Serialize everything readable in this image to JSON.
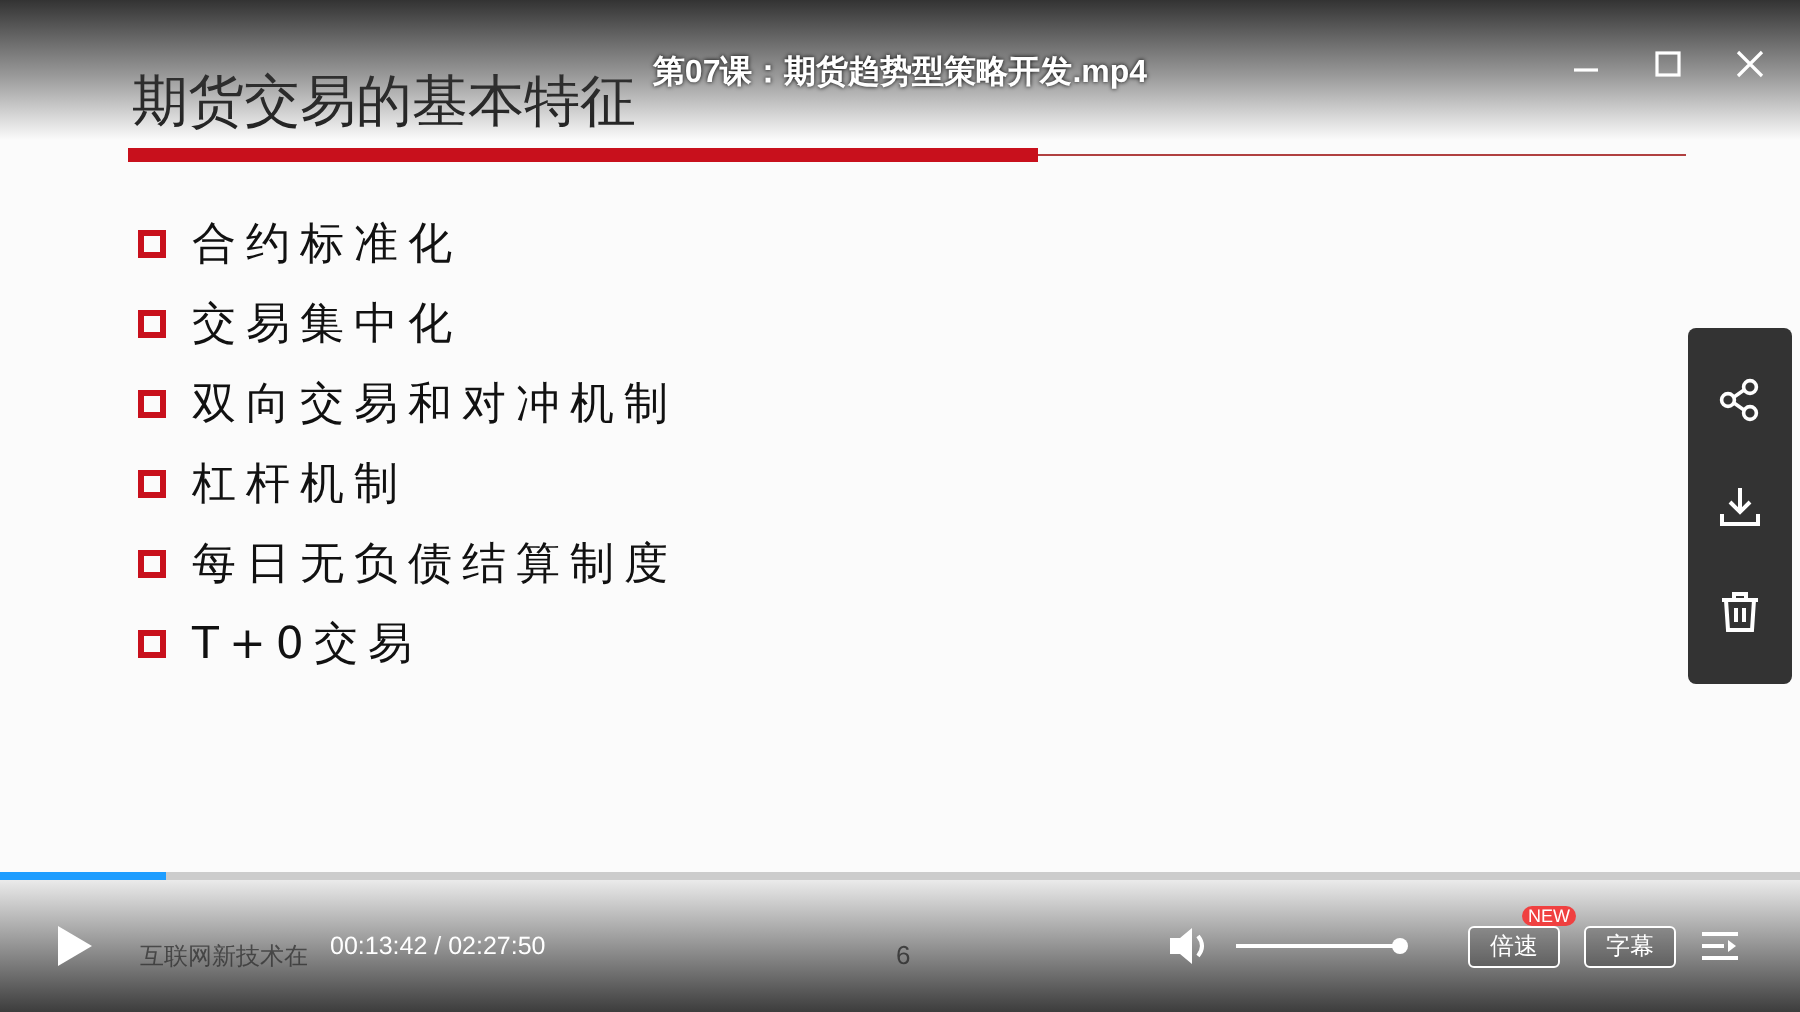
{
  "window": {
    "title": "第07课：期货趋势型策略开发.mp4"
  },
  "slide": {
    "title": "期货交易的基本特征",
    "bullets": [
      "合约标准化",
      "交易集中化",
      "双向交易和对冲机制",
      "杠杆机制",
      "每日无负债结算制度",
      "T+0交易"
    ],
    "footer": "互联网新技术在",
    "page": "6"
  },
  "player": {
    "progress": {
      "level": 0.092
    },
    "time": "00:13:42 / 02:27:50",
    "volume": {
      "level": 0.98
    },
    "speed_button": "倍速",
    "speed_badge": "NEW",
    "subtitle_button": "字幕"
  }
}
